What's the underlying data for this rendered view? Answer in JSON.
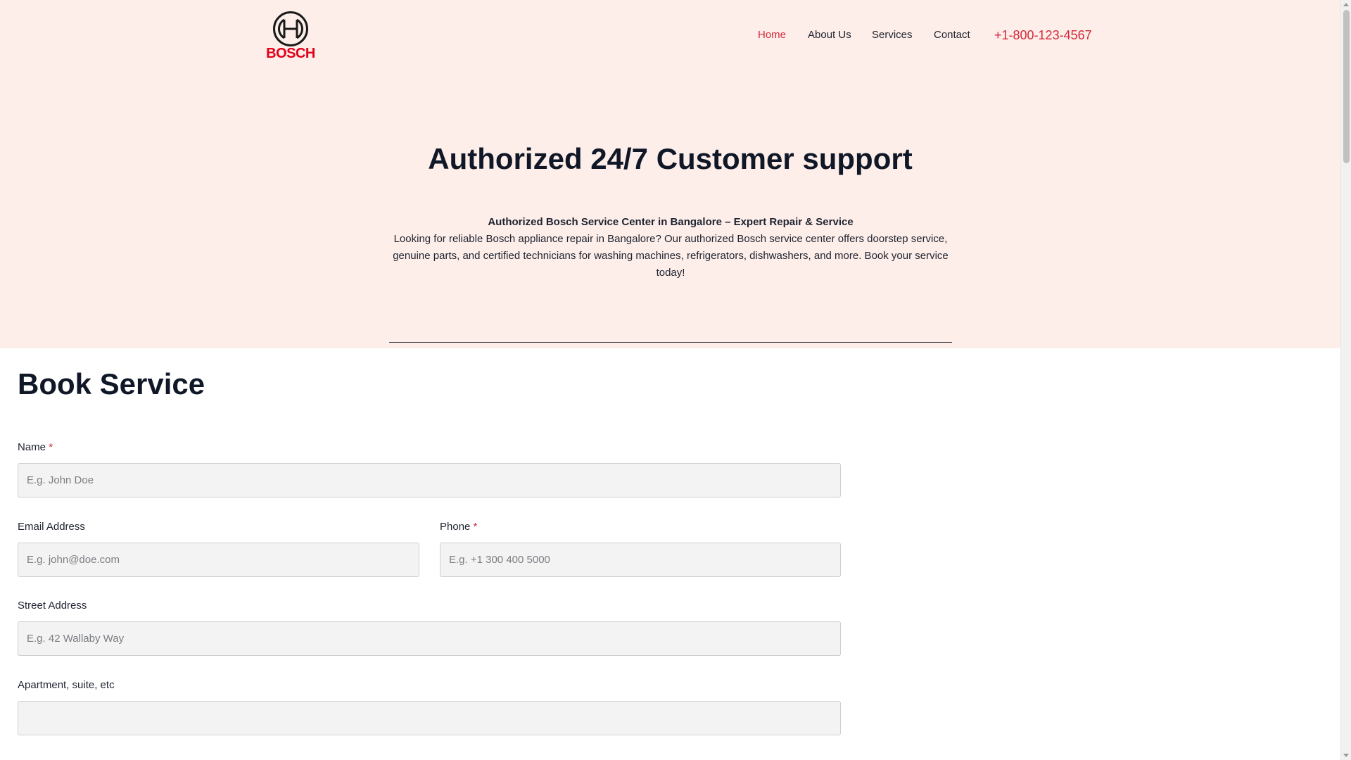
{
  "brand": {
    "logo_text": "BOSCH",
    "logo_icon": "bosch-armature-icon",
    "accent_color": "#e2001a"
  },
  "nav": {
    "items": [
      {
        "label": "Home",
        "active": true
      },
      {
        "label": "About Us",
        "active": false
      },
      {
        "label": "Services",
        "active": false
      },
      {
        "label": "Contact",
        "active": false
      }
    ],
    "phone": "+1-800-123-4567"
  },
  "hero": {
    "title": "Authorized 24/7 Customer support",
    "subtitle": "Authorized Bosch Service Center in Bangalore – Expert Repair & Service",
    "description": "Looking for reliable Bosch appliance repair in Bangalore? Our authorized Bosch service center offers doorstep service, genuine parts, and certified technicians for washing machines, refrigerators, dishwashers, and more. Book your service today!"
  },
  "form": {
    "title": "Book Service",
    "required_marker": "*",
    "name": {
      "label": "Name",
      "placeholder": "E.g. John Doe",
      "value": ""
    },
    "email": {
      "label": "Email Address",
      "placeholder": "E.g. john@doe.com",
      "value": ""
    },
    "phone": {
      "label": "Phone",
      "placeholder": "E.g. +1 300 400 5000",
      "value": ""
    },
    "street": {
      "label": "Street Address",
      "placeholder": "E.g. 42 Wallaby Way",
      "value": ""
    },
    "apartment": {
      "label": "Apartment, suite, etc",
      "placeholder": "",
      "value": ""
    }
  },
  "colors": {
    "hero_background": "#fdeee9",
    "link_active": "#d4283c",
    "heading": "#101828"
  }
}
